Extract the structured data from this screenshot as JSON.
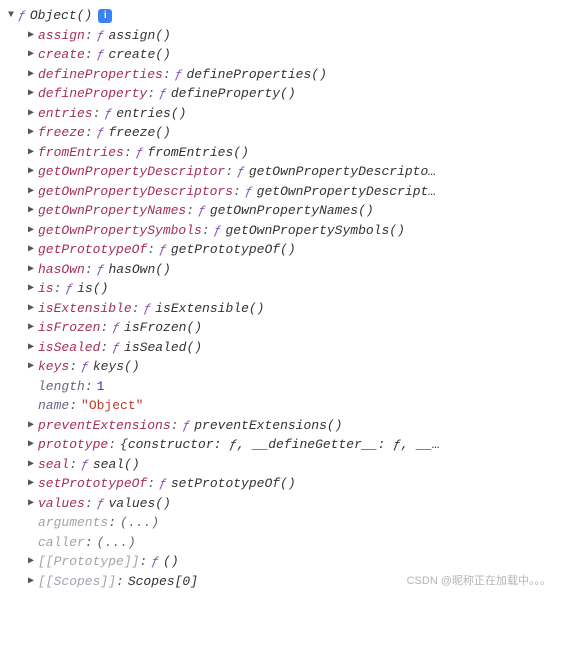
{
  "header": {
    "arrow": "▼",
    "ftoken": "ƒ",
    "fname": "Object()",
    "info": "i"
  },
  "props": [
    {
      "kind": "fn",
      "own": true,
      "key": "assign",
      "val": "assign()"
    },
    {
      "kind": "fn",
      "own": true,
      "key": "create",
      "val": "create()"
    },
    {
      "kind": "fn",
      "own": true,
      "key": "defineProperties",
      "val": "defineProperties()"
    },
    {
      "kind": "fn",
      "own": true,
      "key": "defineProperty",
      "val": "defineProperty()"
    },
    {
      "kind": "fn",
      "own": true,
      "key": "entries",
      "val": "entries()"
    },
    {
      "kind": "fn",
      "own": true,
      "key": "freeze",
      "val": "freeze()"
    },
    {
      "kind": "fn",
      "own": true,
      "key": "fromEntries",
      "val": "fromEntries()"
    },
    {
      "kind": "fn",
      "own": true,
      "key": "getOwnPropertyDescriptor",
      "val": "getOwnPropertyDescripto…"
    },
    {
      "kind": "fn",
      "own": true,
      "key": "getOwnPropertyDescriptors",
      "val": "getOwnPropertyDescript…"
    },
    {
      "kind": "fn",
      "own": true,
      "key": "getOwnPropertyNames",
      "val": "getOwnPropertyNames()"
    },
    {
      "kind": "fn",
      "own": true,
      "key": "getOwnPropertySymbols",
      "val": "getOwnPropertySymbols()"
    },
    {
      "kind": "fn",
      "own": true,
      "key": "getPrototypeOf",
      "val": "getPrototypeOf()"
    },
    {
      "kind": "fn",
      "own": true,
      "key": "hasOwn",
      "val": "hasOwn()"
    },
    {
      "kind": "fn",
      "own": true,
      "key": "is",
      "val": "is()"
    },
    {
      "kind": "fn",
      "own": true,
      "key": "isExtensible",
      "val": "isExtensible()"
    },
    {
      "kind": "fn",
      "own": true,
      "key": "isFrozen",
      "val": "isFrozen()"
    },
    {
      "kind": "fn",
      "own": true,
      "key": "isSealed",
      "val": "isSealed()"
    },
    {
      "kind": "fn",
      "own": true,
      "key": "keys",
      "val": "keys()"
    },
    {
      "kind": "num",
      "own": false,
      "key": "length",
      "val": "1",
      "noarrow": true
    },
    {
      "kind": "str",
      "own": false,
      "key": "name",
      "val": "\"Object\"",
      "noarrow": true
    },
    {
      "kind": "fn",
      "own": true,
      "key": "preventExtensions",
      "val": "preventExtensions()"
    },
    {
      "kind": "obj",
      "own": true,
      "key": "prototype",
      "val": "{constructor: ƒ, __defineGetter__: ƒ, __…"
    },
    {
      "kind": "fn",
      "own": true,
      "key": "seal",
      "val": "seal()"
    },
    {
      "kind": "fn",
      "own": true,
      "key": "setPrototypeOf",
      "val": "setPrototypeOf()"
    },
    {
      "kind": "fn",
      "own": true,
      "key": "values",
      "val": "values()"
    },
    {
      "kind": "ell",
      "own": false,
      "key": "arguments",
      "val": "(...)",
      "noarrow": true,
      "dim": true
    },
    {
      "kind": "ell",
      "own": false,
      "key": "caller",
      "val": "(...)",
      "noarrow": true,
      "dim": true
    },
    {
      "kind": "fn",
      "own": false,
      "key": "[[Prototype]]",
      "val": "()",
      "dim": true
    },
    {
      "kind": "txt",
      "own": false,
      "key": "[[Scopes]]",
      "val": "Scopes[0]",
      "dim": true
    }
  ],
  "ftoken": "ƒ",
  "arrow_closed": "▶",
  "watermark": "CSDN @昵称正在加载中。。。"
}
